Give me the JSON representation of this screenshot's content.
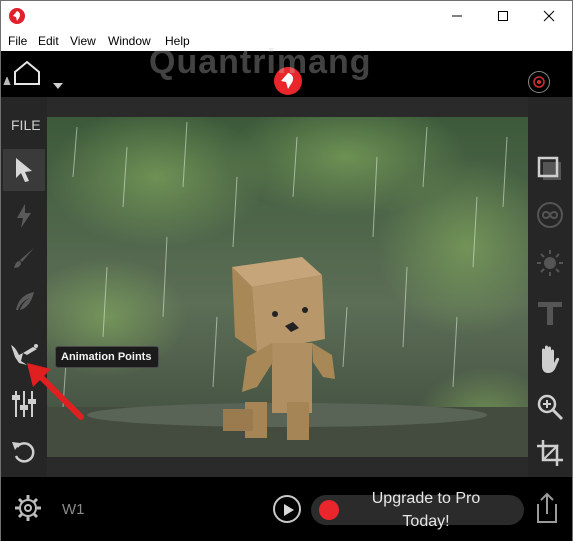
{
  "window": {
    "controls": {
      "minimize": "minimize",
      "maximize": "maximize",
      "close": "close"
    }
  },
  "menu": [
    "File",
    "Edit",
    "View",
    "Window",
    "Help"
  ],
  "watermark": "Quantrimang",
  "sidebar_left": {
    "file_label": "FILE",
    "tools": [
      "select-arrow-icon",
      "lightning-icon",
      "brush-icon",
      "feather-icon",
      "animation-points-icon",
      "sliders-icon",
      "undo-icon"
    ]
  },
  "sidebar_right": {
    "tools": [
      "layers-icon",
      "loop-icon",
      "brightness-icon",
      "text-icon",
      "hand-icon",
      "zoom-icon",
      "crop-icon"
    ]
  },
  "tooltip": "Animation Points",
  "bottom": {
    "w_label": "W1",
    "upgrade_text": "Upgrade to Pro Today!"
  },
  "colors": {
    "brand": "#e8262c",
    "annotation": "#e02020"
  }
}
